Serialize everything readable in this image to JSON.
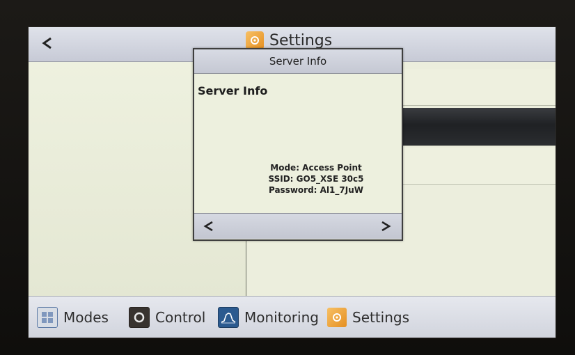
{
  "topbar": {
    "title": "Settings",
    "back_icon": "chevron-left-icon",
    "title_icon": "settings-icon"
  },
  "dialog": {
    "header_title": "Server Info",
    "heading": "Server Info",
    "info": {
      "mode": "Mode: Access Point",
      "ssid": "SSID: GO5_XSE 30c5",
      "password": "Password: Al1_7JuW"
    },
    "prev_icon": "chevron-left-icon",
    "next_icon": "chevron-right-icon"
  },
  "nav": {
    "items": [
      {
        "label": "Modes",
        "icon": "modes-icon"
      },
      {
        "label": "Control",
        "icon": "control-icon"
      },
      {
        "label": "Monitoring",
        "icon": "monitoring-icon"
      },
      {
        "label": "Settings",
        "icon": "settings-icon"
      }
    ]
  },
  "colors": {
    "screen_bg": "#ebeedc",
    "bar_bg": "#c7cad6",
    "selected_row": "#1f2124",
    "settings_accent": "#e58f21",
    "monitoring_accent": "#2b5a8f"
  }
}
